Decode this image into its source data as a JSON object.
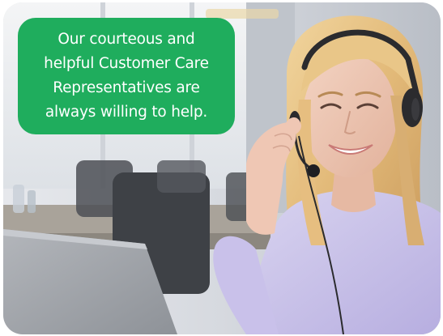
{
  "callout": {
    "text": "Our courteous and\nhelpful Customer Care\nRepresentatives are\nalways willing to help."
  },
  "photo": {
    "subject": "customer-care-representative-with-headset"
  },
  "colors": {
    "callout_bg": "#1fad5d",
    "callout_text": "#ffffff"
  }
}
